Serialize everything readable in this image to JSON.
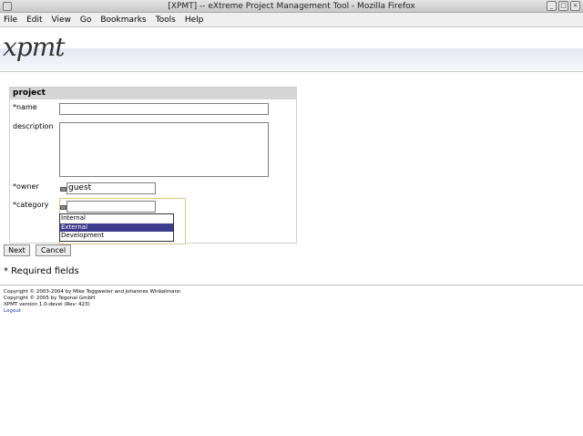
{
  "window": {
    "title": "[XPMT] -- eXtreme Project Management Tool - Mozilla Firefox"
  },
  "menu": [
    "File",
    "Edit",
    "View",
    "Go",
    "Bookmarks",
    "Tools",
    "Help"
  ],
  "banner": {
    "logo": "xpmt"
  },
  "form": {
    "header": "project",
    "name_label": "*name",
    "description_label": "description",
    "owner_label": "*owner",
    "owner_value": "guest",
    "category_label": "*category",
    "category_options": [
      "Internal",
      "External",
      "Development"
    ],
    "category_selected": "External"
  },
  "buttons": {
    "next": "Next",
    "cancel": "Cancel"
  },
  "required_note": "* Required fields",
  "footer": {
    "line1": "Copyright © 2003-2004 by Mike Toggweiler and Johannes Winkelmann",
    "line2": "Copyright © 2005 by Tegonal GmbH",
    "line3": "XPMT version 1.0-devel (Rev: 423)",
    "logout": "Logout"
  }
}
